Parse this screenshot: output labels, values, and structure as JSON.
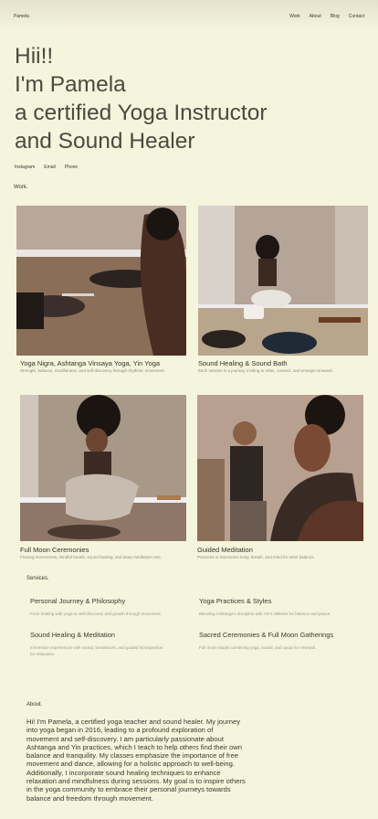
{
  "header": {
    "brand": "Pamela",
    "nav": [
      "Work",
      "About",
      "Blog",
      "Contact"
    ]
  },
  "hero": {
    "lines": [
      "Hii!!",
      "I'm Pamela",
      "a certified Yoga Instructor",
      "and Sound Healer"
    ]
  },
  "links": [
    "Instagram",
    "Email",
    "Phone"
  ],
  "work": {
    "label": "Work.",
    "cards": [
      {
        "title": "Yoga Nigra, Ashtanga Vinsaya Yoga, Yin Yoga",
        "desc": "Strength, balance, mindfulness, and self-discovery through rhythmic movement."
      },
      {
        "title": "Sound Healing & Sound Bath",
        "desc": "Each session is a journey, inviting to relax, connect, and emerge renewed."
      },
      {
        "title": "Full Moon Ceremonies",
        "desc": "Flowing movements, mindful breath, sound healing, and deep meditation rest."
      },
      {
        "title": "Guided Meditation",
        "desc": "Practices to harmonize body, breath, and mind for inner balance."
      }
    ]
  },
  "services": {
    "label": "Services.",
    "items": [
      {
        "title": "Personal Journey & Philosophy",
        "desc": "From healing with yoga to self-discovery and growth through movement."
      },
      {
        "title": "Yoga Practices & Styles",
        "desc": "Blending Ashtanga's discipline with Yin's stillness for balance and peace."
      },
      {
        "title": "Sound Healing & Meditation",
        "desc": "Immersive experiences with sound, breathwork, and guided introspection for relaxation."
      },
      {
        "title": "Sacred Ceremonies & Full Moon Gatherings",
        "desc": "Full moon rituals combining yoga, sound, and cacao for renewal."
      }
    ]
  },
  "about": {
    "label": "About.",
    "text": "Hi! I'm Pamela, a certified yoga teacher and sound healer. My journey into yoga began in 2016, leading to a profound exploration of movement and self-discovery. I am particularly passionate about Ashtanga and Yin practices, which I teach to help others find their own balance and tranquility. My classes emphasize the importance of free movement and dance, allowing for a holistic approach to well-being. Additionally, I incorporate sound healing techniques to enhance relaxation and mindfulness during sessions. My goal is to inspire others in the yoga community to embrace their personal journeys towards balance and freedom through movement."
  }
}
